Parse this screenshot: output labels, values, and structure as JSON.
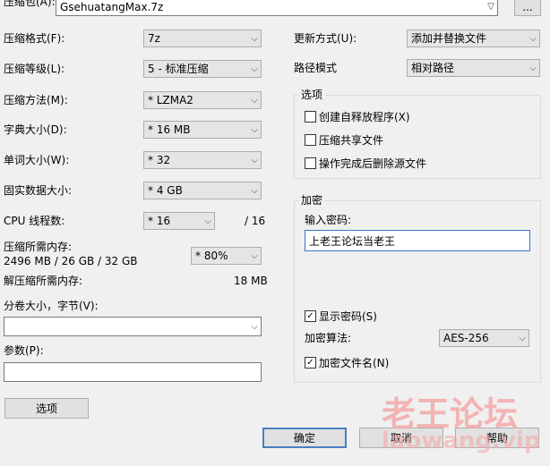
{
  "archive": {
    "label": "压缩包(A):",
    "value": "GsehuatangMax.7z",
    "browse_label": "..."
  },
  "left": {
    "format": {
      "label": "压缩格式(F):",
      "value": "7z"
    },
    "level": {
      "label": "压缩等级(L):",
      "value": "5 - 标准压缩"
    },
    "method": {
      "label": "压缩方法(M):",
      "value": "* LZMA2"
    },
    "dict": {
      "label": "字典大小(D):",
      "value": "* 16 MB"
    },
    "word": {
      "label": "单词大小(W):",
      "value": "* 32"
    },
    "solid": {
      "label": "固实数据大小:",
      "value": "* 4 GB"
    },
    "cpu": {
      "label": "CPU 线程数:",
      "value": "* 16",
      "total": "/ 16"
    },
    "mem": {
      "label": "压缩所需内存:",
      "detail": "2496 MB / 26 GB / 32 GB",
      "value": "* 80%"
    },
    "decomp": {
      "label": "解压缩所需内存:",
      "value": "18 MB"
    },
    "split": {
      "label": "分卷大小，字节(V):",
      "value": ""
    },
    "params": {
      "label": "参数(P):",
      "value": ""
    },
    "options_button": "选项"
  },
  "right": {
    "update": {
      "label": "更新方式(U):",
      "value": "添加并替换文件"
    },
    "path": {
      "label": "路径模式",
      "value": "相对路径"
    },
    "options_group": {
      "title": "选项",
      "sfx": {
        "label": "创建自释放程序(X)",
        "checked": false
      },
      "shared": {
        "label": "压缩共享文件",
        "checked": false
      },
      "delete": {
        "label": "操作完成后删除源文件",
        "checked": false
      }
    },
    "encryption": {
      "title": "加密",
      "password_label": "输入密码:",
      "password_value": "上老王论坛当老王",
      "show_password": {
        "label": "显示密码(S)",
        "checked": true
      },
      "algo_label": "加密算法:",
      "algo_value": "AES-256",
      "encrypt_names": {
        "label": "加密文件名(N)",
        "checked": true
      }
    }
  },
  "buttons": {
    "ok": "确定",
    "cancel": "取消",
    "help": "帮助"
  },
  "watermark": {
    "line1": "老王论坛",
    "line2": "laowang.vip",
    "color": "#f4a9a9"
  },
  "icons": {
    "dropdown": "chevron-down-icon",
    "check": "check-icon"
  }
}
